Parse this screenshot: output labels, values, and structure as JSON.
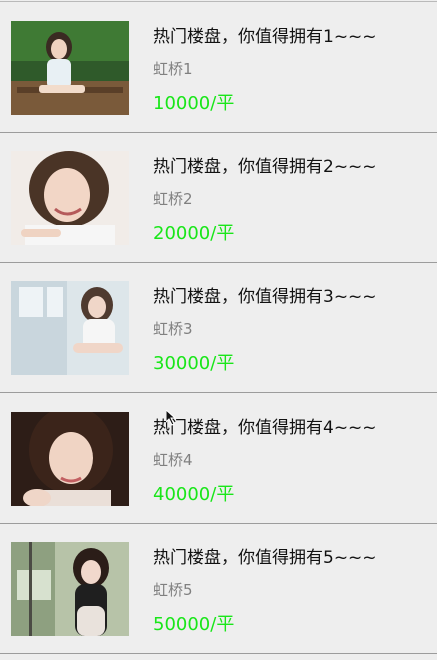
{
  "list": {
    "items": [
      {
        "image_icon": "photo-thumbnail",
        "title": "热门楼盘，你值得拥有1~~~",
        "location": "虹桥1",
        "price": "10000/平"
      },
      {
        "image_icon": "photo-thumbnail",
        "title": "热门楼盘，你值得拥有2~~~",
        "location": "虹桥2",
        "price": "20000/平"
      },
      {
        "image_icon": "photo-thumbnail",
        "title": "热门楼盘，你值得拥有3~~~",
        "location": "虹桥3",
        "price": "30000/平"
      },
      {
        "image_icon": "photo-thumbnail",
        "title": "热门楼盘，你值得拥有4~~~",
        "location": "虹桥4",
        "price": "40000/平"
      },
      {
        "image_icon": "photo-thumbnail",
        "title": "热门楼盘，你值得拥有5~~~",
        "location": "虹桥5",
        "price": "50000/平"
      }
    ]
  },
  "colors": {
    "background": "#eeeeee",
    "title": "#111111",
    "location": "#808080",
    "price": "#19e619",
    "divider": "#9c9c9c"
  }
}
